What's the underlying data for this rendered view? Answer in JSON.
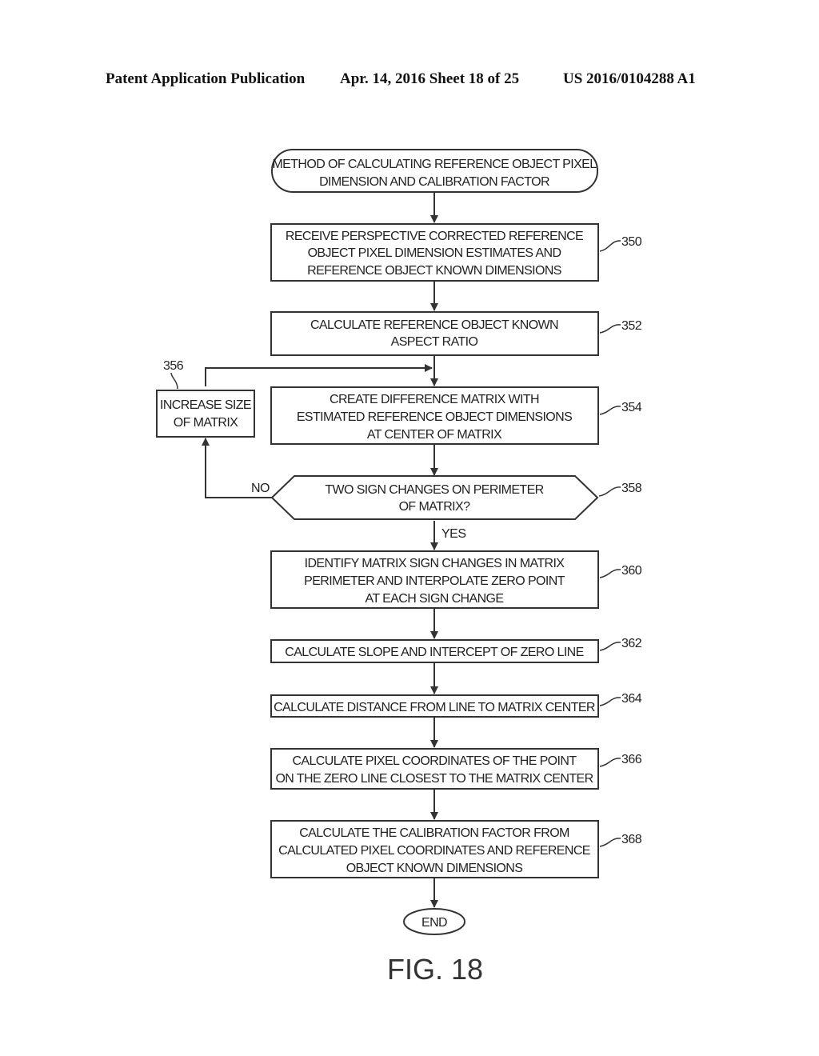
{
  "header": {
    "left": "Patent Application Publication",
    "middle": "Apr. 14, 2016  Sheet 18 of 25",
    "right": "US 2016/0104288 A1"
  },
  "flowchart": {
    "start": {
      "lines": [
        "METHOD OF CALCULATING REFERENCE OBJECT PIXEL",
        "DIMENSION AND CALIBRATION FACTOR"
      ]
    },
    "steps": {
      "s350": {
        "ref": "350",
        "lines": [
          "RECEIVE PERSPECTIVE CORRECTED REFERENCE",
          "OBJECT PIXEL DIMENSION ESTIMATES AND",
          "REFERENCE OBJECT KNOWN DIMENSIONS"
        ]
      },
      "s352": {
        "ref": "352",
        "lines": [
          "CALCULATE REFERENCE OBJECT KNOWN",
          "ASPECT RATIO"
        ]
      },
      "s354": {
        "ref": "354",
        "lines": [
          "CREATE DIFFERENCE MATRIX WITH",
          "ESTIMATED REFERENCE OBJECT DIMENSIONS",
          "AT CENTER OF MATRIX"
        ]
      },
      "s356": {
        "ref": "356",
        "lines": [
          "INCREASE SIZE",
          "OF MATRIX"
        ]
      },
      "s358": {
        "ref": "358",
        "lines": [
          "TWO SIGN CHANGES ON PERIMETER",
          "OF MATRIX?"
        ],
        "no_label": "NO",
        "yes_label": "YES"
      },
      "s360": {
        "ref": "360",
        "lines": [
          "IDENTIFY MATRIX SIGN CHANGES IN MATRIX",
          "PERIMETER AND INTERPOLATE ZERO POINT",
          "AT EACH SIGN CHANGE"
        ]
      },
      "s362": {
        "ref": "362",
        "lines": [
          "CALCULATE SLOPE AND INTERCEPT OF ZERO LINE"
        ]
      },
      "s364": {
        "ref": "364",
        "lines": [
          "CALCULATE DISTANCE FROM LINE TO MATRIX CENTER"
        ]
      },
      "s366": {
        "ref": "366",
        "lines": [
          "CALCULATE PIXEL COORDINATES OF THE POINT",
          "ON THE ZERO LINE CLOSEST TO THE MATRIX CENTER"
        ]
      },
      "s368": {
        "ref": "368",
        "lines": [
          "CALCULATE THE CALIBRATION FACTOR FROM",
          "CALCULATED PIXEL COORDINATES AND REFERENCE",
          "OBJECT KNOWN DIMENSIONS"
        ]
      }
    },
    "end": {
      "label": "END"
    }
  },
  "figure_label": "FIG. 18"
}
